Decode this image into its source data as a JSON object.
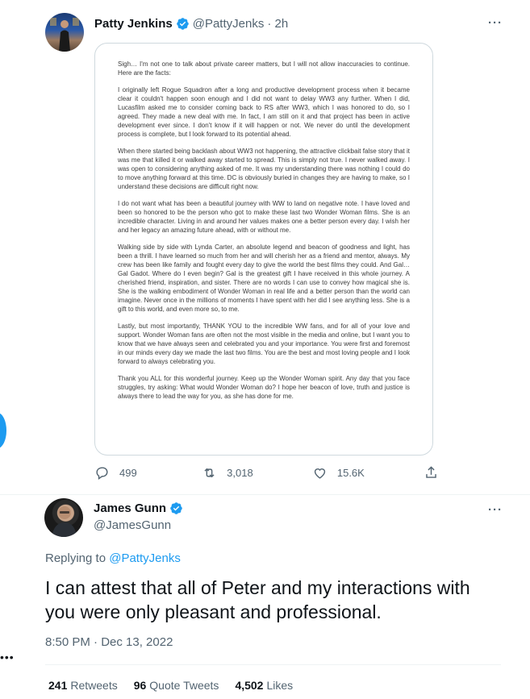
{
  "tweet1": {
    "author_name": "Patty Jenkins",
    "author_handle": "@PattyJenks",
    "time": "· 2h",
    "more": "···",
    "image_text": [
      "Sigh… I'm not one to talk about private career matters, but I will not allow inaccuracies to continue. Here are the facts:",
      "I originally left Rogue Squadron after a long and productive development process when it became clear it couldn't happen soon enough and I did not want to delay WW3 any further. When I did, Lucasfilm asked me to consider coming back to RS after WW3, which I was honored to do, so I agreed. They made a new deal with me. In fact, I am still on it and that project has been in active development ever since. I don't know if it will happen or not. We never do until the development process is complete, but I look forward to its potential ahead.",
      "When there started being backlash about WW3 not happening, the attractive clickbait false story that it was me that killed it or walked away started to spread. This is simply not true. I never walked away. I was open to considering anything asked of me. It was my understanding there was nothing I could do to move anything forward at this time. DC is obviously buried in changes they are having to make, so I understand these decisions are difficult right now.",
      "I do not want what has been a beautiful journey with WW to land on negative note. I have loved and been so honored to be the person who got to make these last two Wonder Woman films. She is an incredible character. Living in and around her values makes one a better person every day. I wish her and her legacy an amazing future ahead, with or without me.",
      "Walking side by side with Lynda Carter, an absolute legend and beacon of goodness and light, has been a thrill. I have learned so much from her and will cherish her as a friend and mentor, always. My crew has been like family and fought every day to give the world the best films they could. And Gal… Gal Gadot. Where do I even begin? Gal is the greatest gift I have received in this whole journey. A cherished friend, inspiration, and sister. There are no words I can use to convey how magical she is. She is the walking embodiment of Wonder Woman in real life and a better person than the world can imagine. Never once in the millions of moments I have spent with her did I see anything less. She is a gift to this world, and even more so, to me.",
      "Lastly, but most importantly, THANK YOU to the incredible WW fans, and for all of your love and support. Wonder Woman fans are often not the most visible in the media and online, but I want you to know that we have always seen and celebrated you and your importance. You were first and foremost in our minds every day we made the last two films. You are the best and most loving people and I look forward to always celebrating you.",
      "Thank you ALL for this wonderful journey. Keep up the Wonder Woman spirit. Any day that you face struggles, try asking: What would Wonder Woman do? I hope her beacon of love, truth and justice is always there to lead the way for you, as she has done for me."
    ],
    "replies": "499",
    "retweets": "3,018",
    "likes": "15.6K"
  },
  "tweet2": {
    "author_name": "James Gunn",
    "author_handle": "@JamesGunn",
    "more": "···",
    "replying_prefix": "Replying to",
    "replying_to": "@PattyJenks",
    "text": "I can attest that all of Peter and my interactions with you were only pleasant and professional.",
    "timestamp": "8:50 PM · Dec 13, 2022",
    "retweets_count": "241",
    "retweets_label": "Retweets",
    "quotes_count": "96",
    "quotes_label": "Quote Tweets",
    "likes_count": "4,502",
    "likes_label": "Likes"
  },
  "left_edge_dots": "•••",
  "colors": {
    "accent": "#1d9bf0",
    "muted": "#536471",
    "text": "#0f1419",
    "border": "#eff3f4"
  },
  "icons": [
    "verified-badge-icon",
    "reply-icon",
    "retweet-icon",
    "like-icon",
    "share-icon",
    "more-icon"
  ]
}
